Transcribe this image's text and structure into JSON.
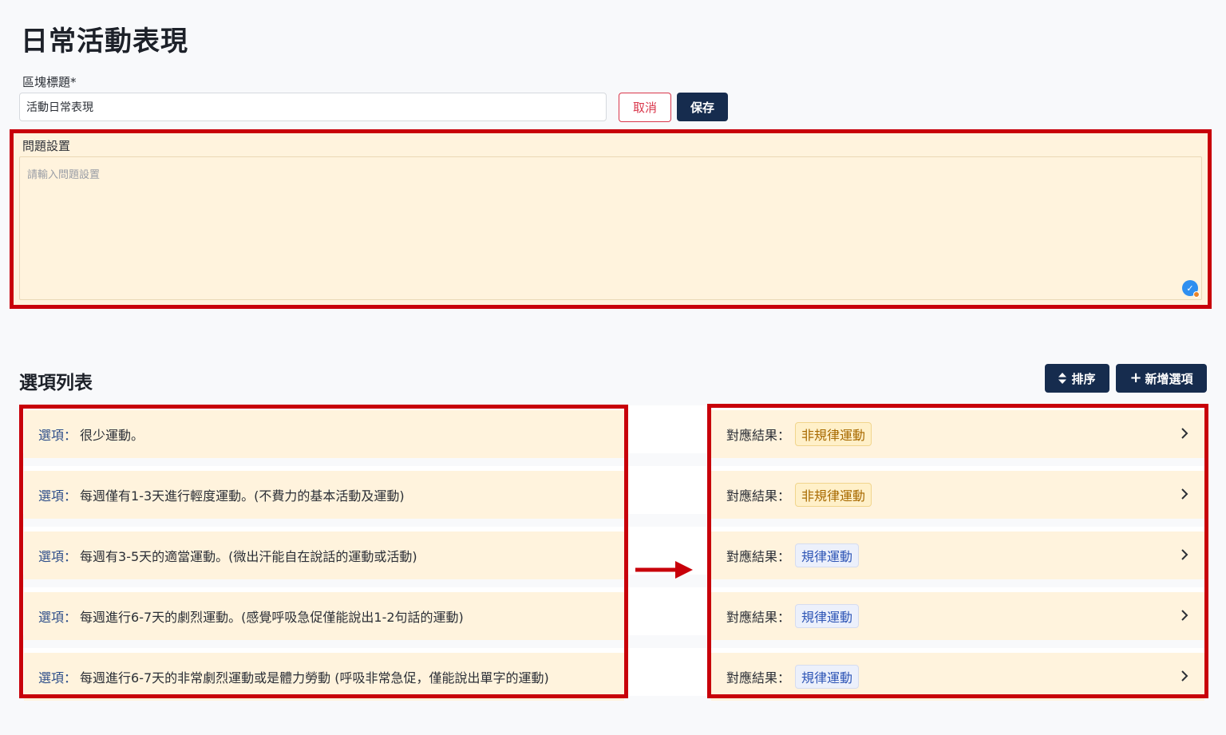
{
  "page": {
    "title": "日常活動表現"
  },
  "block_title": {
    "label": "區塊標題*",
    "value": "活動日常表現"
  },
  "actions": {
    "cancel_label": "取消",
    "save_label": "保存"
  },
  "question": {
    "label": "問題設置",
    "placeholder": "請輸入問題設置"
  },
  "options": {
    "section_title": "選項列表",
    "sort_label": "排序",
    "add_label": "新增選項",
    "option_prefix": "選項：",
    "result_prefix": "對應結果：",
    "items": [
      {
        "text": "很少運動。",
        "result": "非規律運動",
        "result_kind": "irregular"
      },
      {
        "text": "每週僅有1-3天進行輕度運動。(不費力的基本活動及運動)",
        "result": "非規律運動",
        "result_kind": "irregular"
      },
      {
        "text": "每週有3-5天的適當運動。(微出汗能自在說話的運動或活動)",
        "result": "規律運動",
        "result_kind": "regular"
      },
      {
        "text": "每週進行6-7天的劇烈運動。(感覺呼吸急促僅能說出1-2句話的運動)",
        "result": "規律運動",
        "result_kind": "regular"
      },
      {
        "text": "每週進行6-7天的非常劇烈運動或是體力勞動 (呼吸非常急促，僅能說出單字的運動)",
        "result": "規律運動",
        "result_kind": "regular"
      }
    ]
  },
  "colors": {
    "highlight_border": "#c8000a",
    "primary_button": "#162c4e",
    "row_background": "#fff3dd",
    "irregular_tag": "#a86a00",
    "regular_tag": "#2f56b6"
  },
  "icons": {
    "sort": "sort-icon",
    "add": "plus-icon",
    "chevron": "chevron-right-icon",
    "arrow": "right-arrow-icon",
    "grammar": "grammar-check-icon"
  }
}
